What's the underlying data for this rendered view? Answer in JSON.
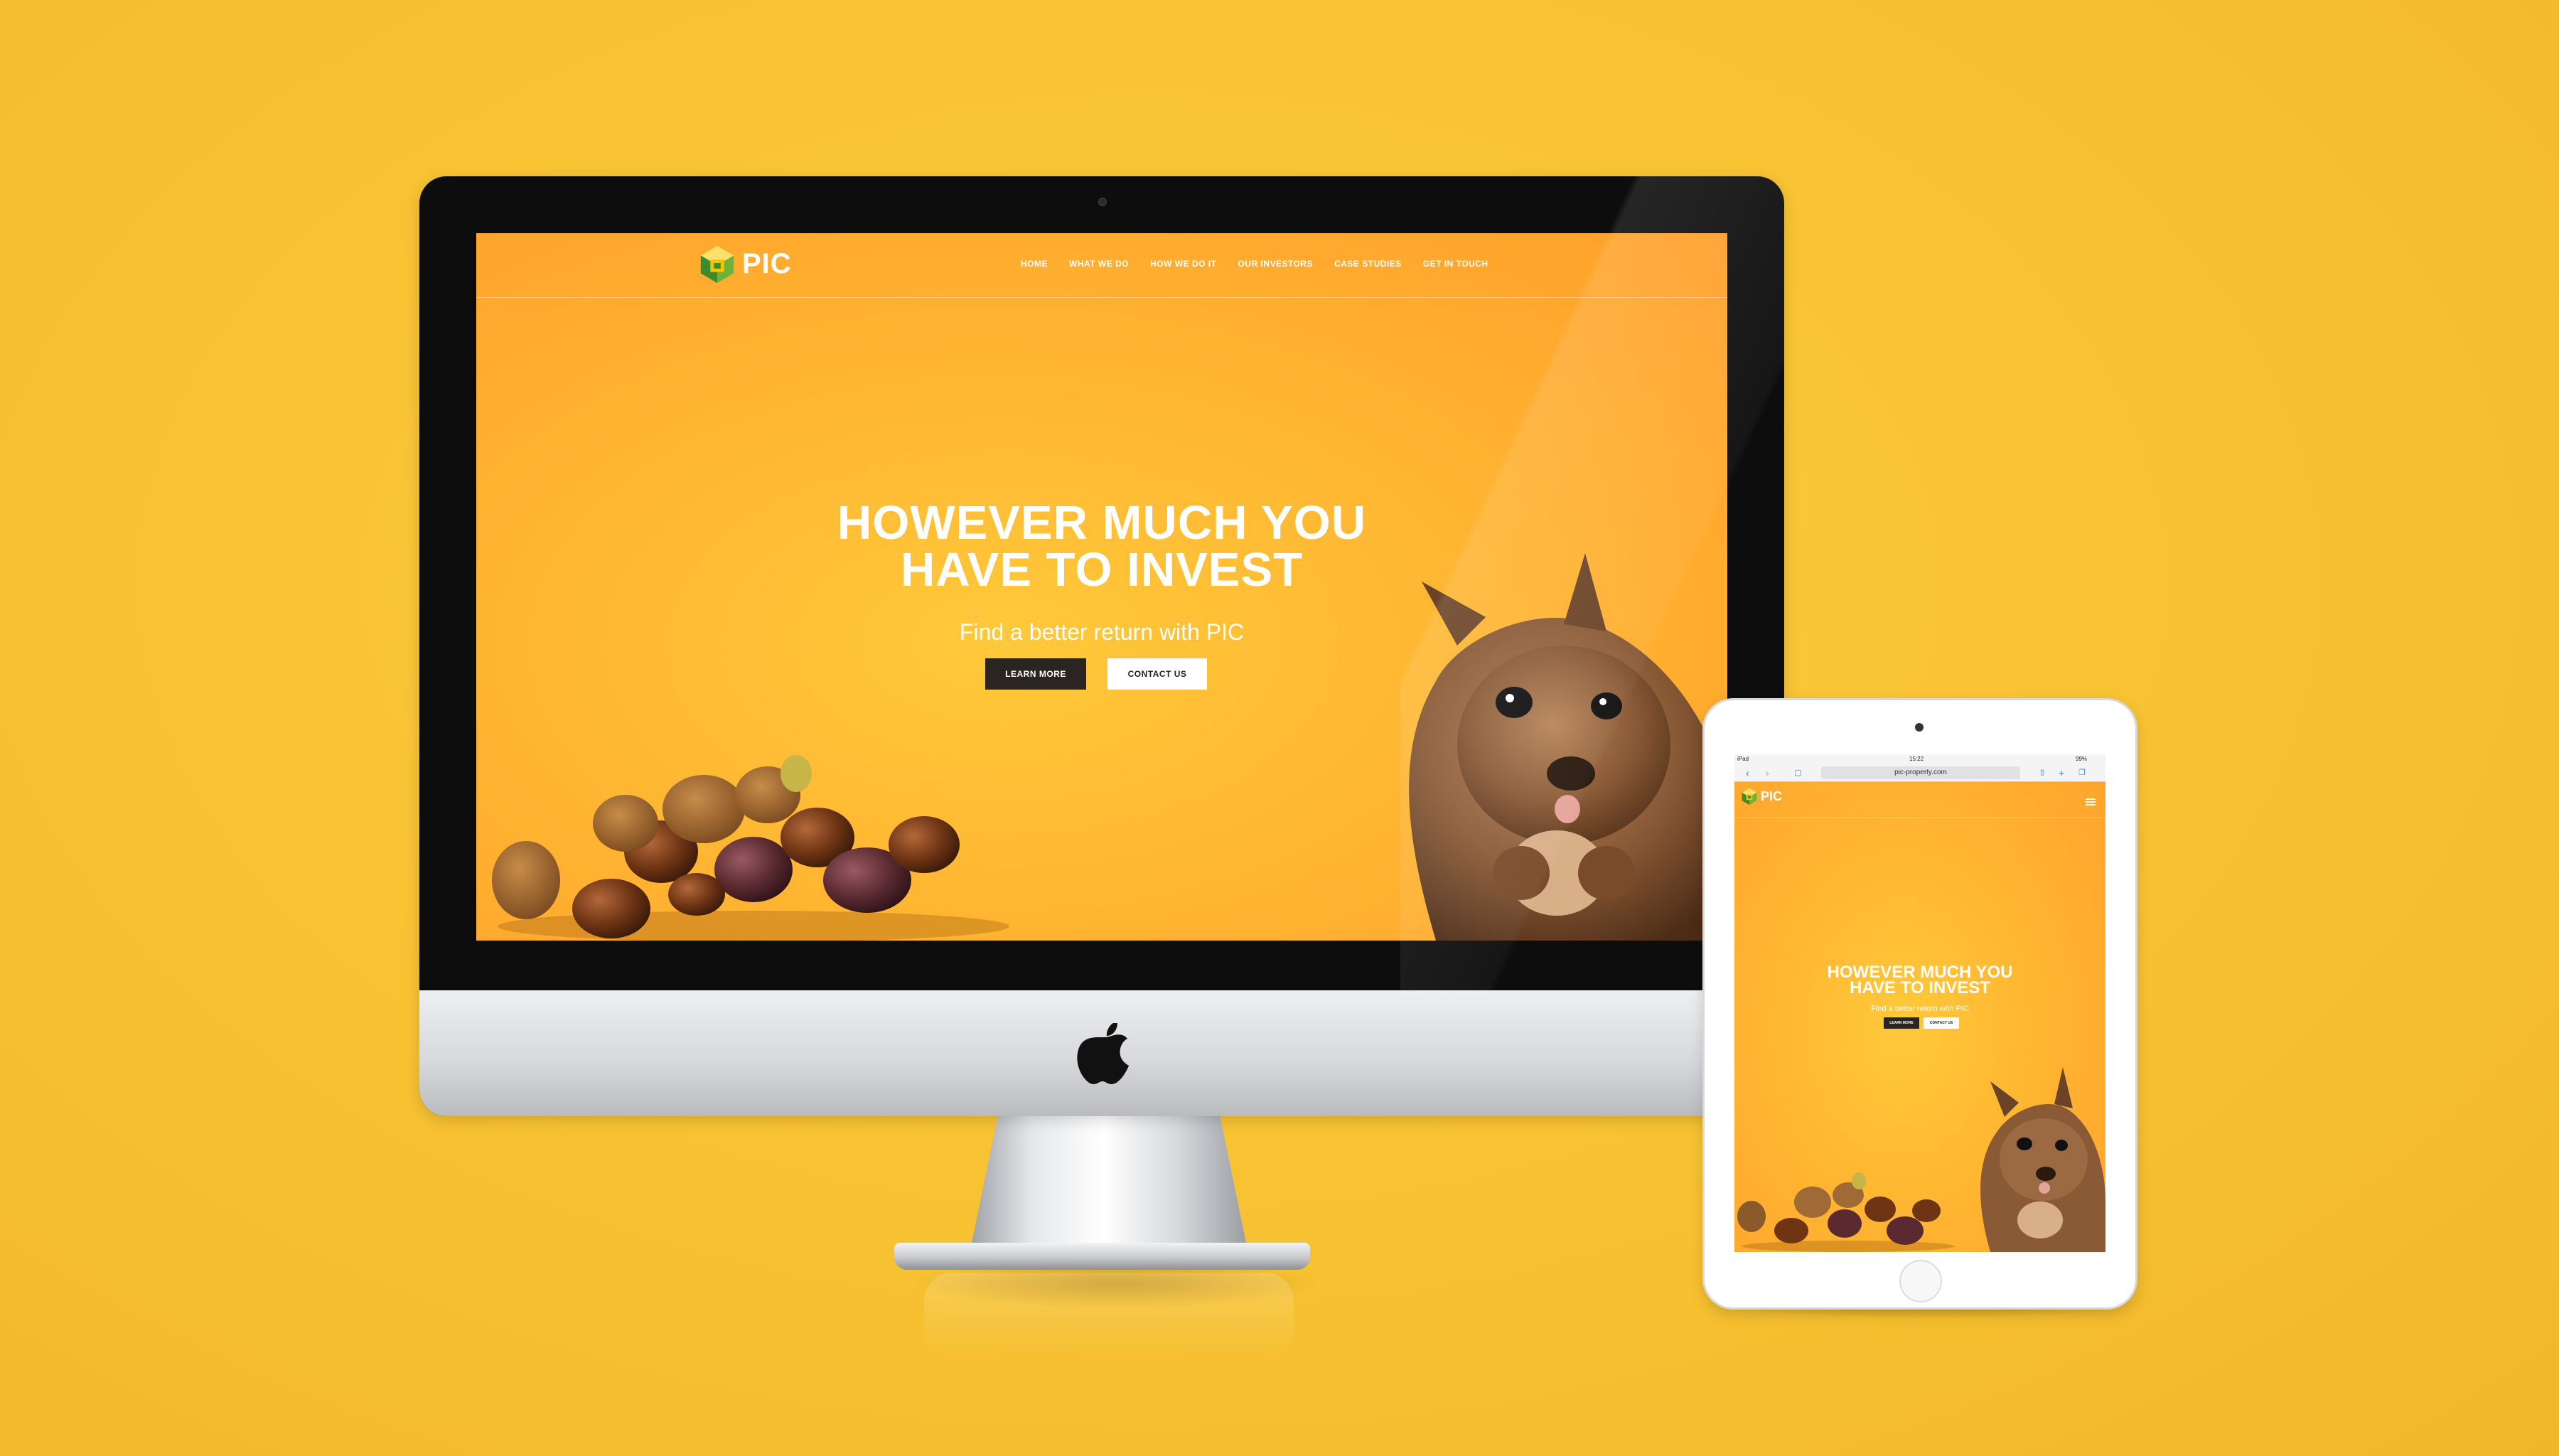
{
  "colors": {
    "background": "#f7c231",
    "hero_orange": "#ffb632",
    "button_dark": "#2a2523",
    "button_light": "#ffffff",
    "logo_green": "#3e8b2f",
    "logo_yellow": "#f5c400"
  },
  "site": {
    "logo_text": "PIC",
    "nav": [
      "HOME",
      "WHAT WE DO",
      "HOW WE DO IT",
      "OUR INVESTORS",
      "CASE STUDIES",
      "GET IN TOUCH"
    ],
    "hero": {
      "title_line1": "HOWEVER MUCH YOU",
      "title_line2": "HAVE TO INVEST",
      "subtitle": "Find a better return with PIC",
      "learn_more": "LEARN MORE",
      "contact_us": "CONTACT US"
    }
  },
  "tablet": {
    "status": {
      "device": "iPad",
      "time": "15:22",
      "battery": "99%"
    },
    "url": "pic-property.com",
    "logo_text": "PIC",
    "hero": {
      "title_line1": "HOWEVER MUCH YOU",
      "title_line2": "HAVE TO INVEST",
      "subtitle": "Find a better return with PIC",
      "learn_more": "LEARN MORE",
      "contact_us": "CONTACT US"
    }
  },
  "icons": {
    "apple": "apple-logo-icon",
    "menu": "hamburger-menu-icon"
  }
}
